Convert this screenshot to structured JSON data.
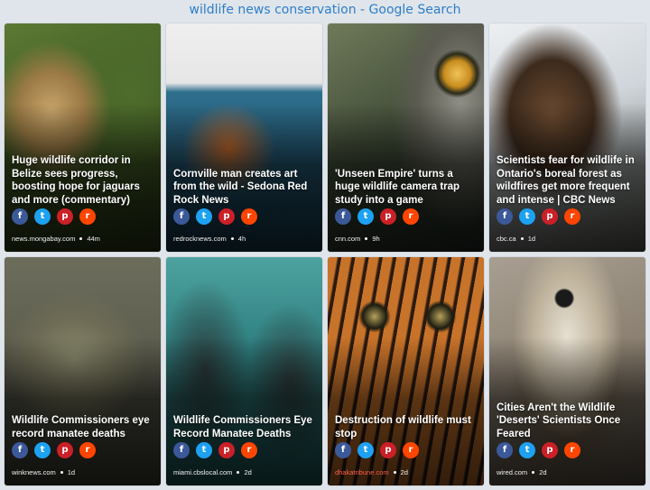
{
  "page": {
    "title": "wildlife news conservation - Google Search"
  },
  "share_icons": [
    {
      "name": "facebook-icon",
      "glyph": "f"
    },
    {
      "name": "twitter-icon",
      "glyph": "t"
    },
    {
      "name": "pinterest-icon",
      "glyph": "p"
    },
    {
      "name": "reddit-icon",
      "glyph": "r"
    }
  ],
  "cards": [
    {
      "title": "Huge wildlife corridor in Belize sees progress, boosting hope for jaguars and more (commentary)",
      "source": "news.mongabay.com",
      "age": "44m",
      "photo": "jaguar"
    },
    {
      "title": "Cornville man creates art from the wild - Sedona Red Rock News",
      "source": "redrocknews.com",
      "age": "4h",
      "photo": "art"
    },
    {
      "title": "'Unseen Empire' turns a huge wildlife camera trap study into a game",
      "source": "cnn.com",
      "age": "9h",
      "photo": "animal-eye"
    },
    {
      "title": "Scientists fear for wildlife in Ontario's boreal forest as wildfires get more frequent and intense | CBC News",
      "source": "cbc.ca",
      "age": "1d",
      "photo": "wolverine"
    },
    {
      "title": "Wildlife Commissioners eye record manatee deaths",
      "source": "winknews.com",
      "age": "1d",
      "photo": "manatee-murky"
    },
    {
      "title": "Wildlife Commissioners Eye Record Manatee Deaths",
      "source": "miami.cbslocal.com",
      "age": "2d",
      "photo": "manatees"
    },
    {
      "title": "Destruction of wildlife must stop",
      "source": "dhakatribune.com",
      "age": "2d",
      "photo": "tiger"
    },
    {
      "title": "Cities Aren't the Wildlife 'Deserts' Scientists Once Feared",
      "source": "wired.com",
      "age": "2d",
      "photo": "falcon"
    }
  ]
}
